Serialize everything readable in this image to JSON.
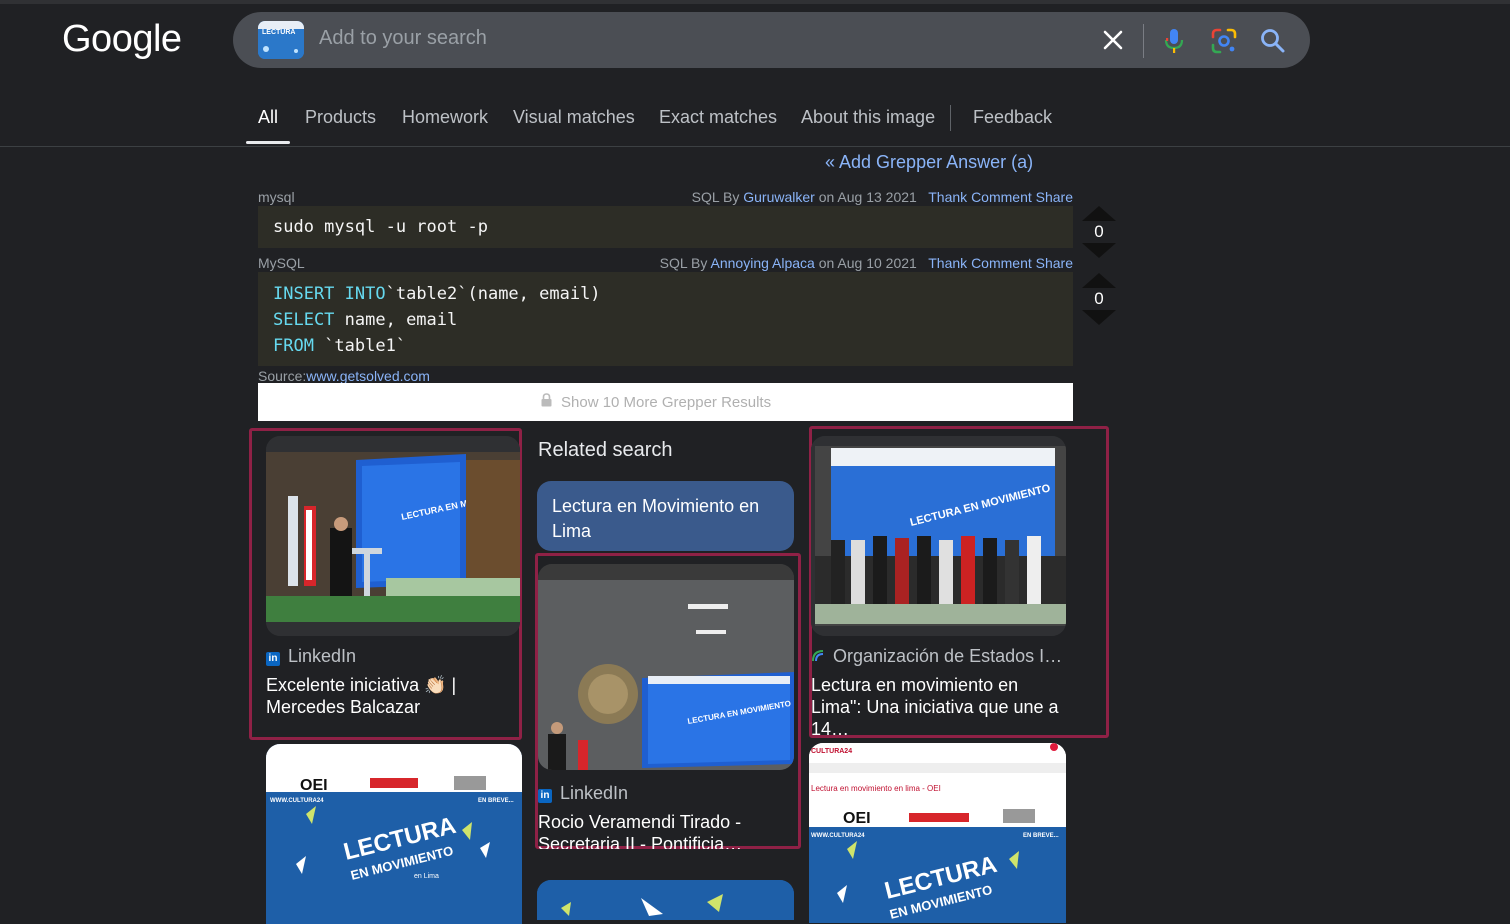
{
  "header": {
    "logo_text": "Google",
    "search": {
      "thumbnail_text": "LECTURA",
      "placeholder": "Add to your search"
    },
    "icons": [
      "close-icon",
      "mic-icon",
      "lens-icon",
      "search-icon"
    ]
  },
  "tabs": [
    {
      "label": "All",
      "active": true
    },
    {
      "label": "Products"
    },
    {
      "label": "Homework"
    },
    {
      "label": "Visual matches"
    },
    {
      "label": "Exact matches"
    },
    {
      "label": "About this image"
    },
    {
      "label": "Feedback"
    }
  ],
  "grepper": {
    "add_answer": "« Add Grepper Answer (a)",
    "answers": [
      {
        "lang": "mysql",
        "meta_prefix": "SQL By ",
        "author": "Guruwalker",
        "date": " on Aug 13 2021",
        "actions": [
          "Thank",
          "Comment",
          "Share"
        ],
        "code_lines": [
          "sudo mysql -u root -p"
        ],
        "votes": "0"
      },
      {
        "lang": "MySQL",
        "meta_prefix": "SQL By ",
        "author": "Annoying Alpaca",
        "date": " on Aug 10 2021",
        "actions": [
          "Thank",
          "Comment",
          "Share"
        ],
        "code_lines": [
          {
            "kw": "INSERT",
            "kw2": " INTO",
            "rest": "`table2`(name, email)"
          },
          {
            "kw": "SELECT",
            "rest": " name, email"
          },
          {
            "kw": "FROM",
            "rest": " `table1`"
          }
        ],
        "votes": "0"
      }
    ],
    "source_label": "Source:",
    "source_link": "www.getsolved.com",
    "show_more": "Show 10 More Grepper Results"
  },
  "results": {
    "related_heading": "Related search",
    "related_pill": "Lectura en Movimiento en Lima",
    "cards": [
      {
        "source": "LinkedIn",
        "title": "Excelente iniciativa 👏🏻 | Mercedes Balcazar",
        "image_text": "LECTURA EN MOVIMIENTO"
      },
      {
        "source": "LinkedIn",
        "title": "Rocio Veramendi Tirado - Secretaria II - Pontificia…",
        "image_text": "LECTURA EN MOVIMIENTO"
      },
      {
        "source": "Organización de Estados I…",
        "title": "Lectura en movimiento en Lima\": Una iniciativa que une a 14…",
        "image_text": "LECTURA EN MOVIMIENTO"
      }
    ],
    "poster_small": {
      "oei": "OEI",
      "brand": "WWW.CULTURA24",
      "enbreve": "EN BREVE...",
      "title": "LECTURA",
      "sub": "EN MOVIMIENTO",
      "city": "en Lima"
    },
    "poster_right_caption": "Lectura en movimiento en lima - OEI",
    "poster_right_brand": "CULTURA24"
  },
  "colors": {
    "background": "#202124",
    "link": "#8ab4f8",
    "highlight_box": "#8f2146",
    "pill": "#3a5a8c"
  }
}
